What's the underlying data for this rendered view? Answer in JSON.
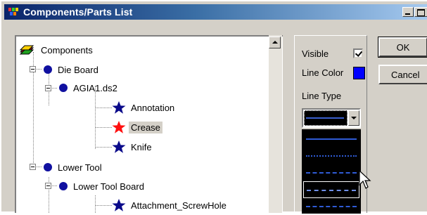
{
  "window": {
    "title": "Components/Parts List",
    "controls": {
      "minimize": "minimize",
      "maximize": "maximize"
    }
  },
  "tree": {
    "nodes": [
      {
        "label": "Components",
        "icon": "components-stack-icon",
        "level": 0
      },
      {
        "label": "Die Board",
        "icon": "blue-disc-icon",
        "level": 1
      },
      {
        "label": "AGIA1.ds2",
        "icon": "blue-disc-icon",
        "level": 2
      },
      {
        "label": "Annotation",
        "icon": "blue-star-icon",
        "level": 3
      },
      {
        "label": "Crease",
        "icon": "red-star-icon",
        "level": 3,
        "selected": true
      },
      {
        "label": "Knife",
        "icon": "blue-star-icon",
        "level": 3
      },
      {
        "label": "Lower Tool",
        "icon": "blue-disc-icon",
        "level": 1
      },
      {
        "label": "Lower Tool Board",
        "icon": "blue-disc-icon",
        "level": 2
      },
      {
        "label": "Attachment_ScrewHole",
        "icon": "blue-star-icon",
        "level": 3
      }
    ]
  },
  "props": {
    "visible_label": "Visible",
    "visible_checked": true,
    "line_color_label": "Line Color",
    "line_color": "#0000ff",
    "line_type_label": "Line Type",
    "line_type_options": [
      "solid",
      "dash",
      "dash-dot",
      "dash-long",
      "dash-dot-dot"
    ],
    "line_type_selected": "dash-long"
  },
  "buttons": {
    "ok": "OK",
    "cancel": "Cancel"
  },
  "colors": {
    "title_start": "#0a246a",
    "title_end": "#a6caf0",
    "face": "#d4d0c8",
    "line_blue": "#2f5bd6"
  }
}
